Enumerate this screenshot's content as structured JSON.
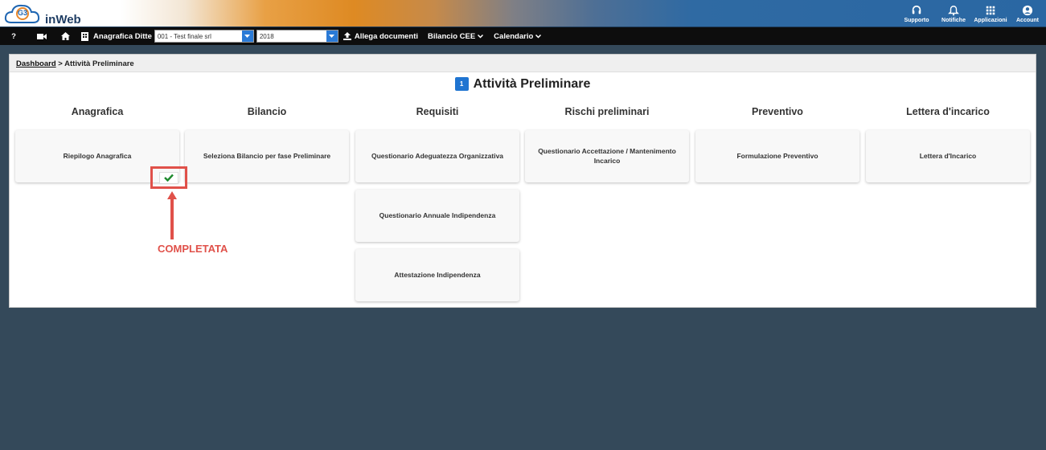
{
  "header": {
    "logo_badge": "G3",
    "logo_text": "inWeb",
    "icons": [
      {
        "label": "Supporto",
        "icon": "headset-icon"
      },
      {
        "label": "Notifiche",
        "icon": "bell-icon"
      },
      {
        "label": "Applicazioni",
        "icon": "grid-icon"
      },
      {
        "label": "Account",
        "icon": "user-circle-icon"
      }
    ]
  },
  "toolbar": {
    "help": "?",
    "anagrafica_label": "Anagrafica Ditte",
    "company_value": "001 - Test finale srl",
    "year_value": "2018",
    "allega_label": "Allega documenti",
    "bilancio_label": "Bilancio CEE",
    "calendario_label": "Calendario"
  },
  "breadcrumb": {
    "dashboard": "Dashboard",
    "separator": ">",
    "current": "Attività Preliminare"
  },
  "page": {
    "step_number": "1",
    "title": "Attività Preliminare"
  },
  "columns": [
    {
      "heading": "Anagrafica",
      "cards": [
        "Riepilogo Anagrafica"
      ]
    },
    {
      "heading": "Bilancio",
      "cards": [
        "Seleziona Bilancio per fase Preliminare"
      ]
    },
    {
      "heading": "Requisiti",
      "cards": [
        "Questionario Adeguatezza Organizzativa",
        "Questionario Annuale Indipendenza",
        "Attestazione Indipendenza"
      ]
    },
    {
      "heading": "Rischi preliminari",
      "cards": [
        "Questionario Accettazione / Mantenimento Incarico"
      ]
    },
    {
      "heading": "Preventivo",
      "cards": [
        "Formulazione Preventivo"
      ]
    },
    {
      "heading": "Lettera d'incarico",
      "cards": [
        "Lettera d'Incarico"
      ]
    }
  ],
  "annotation": {
    "label": "COMPLETATA",
    "color": "#e0514a"
  },
  "colors": {
    "background": "#34495a",
    "toolbar": "#0d0d0d",
    "accent_blue": "#1f74d1",
    "check_green": "#1e8a2e"
  }
}
